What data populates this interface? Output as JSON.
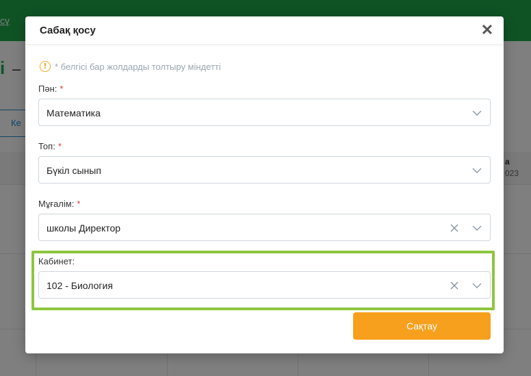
{
  "background": {
    "header_link": "сү",
    "title_fragment": "і",
    "title_dash": "–",
    "button_fragment": "Ке",
    "column_header": "а",
    "column_sub": "023"
  },
  "modal": {
    "title": "Сабақ қосу",
    "close_symbol": "✕",
    "info_icon_symbol": "!",
    "info_text": "* белгісі бар жолдарды толтыру міндетті",
    "required_marker": "*",
    "fields": {
      "subject": {
        "label": "Пән:",
        "value": "Математика",
        "required": true
      },
      "group": {
        "label": "Топ:",
        "value": "Бүкіл сынып",
        "required": true
      },
      "teacher": {
        "label": "Мұғалім:",
        "value": "школы Директор",
        "required": true
      },
      "room": {
        "label": "Кабинет:",
        "value": "102 - Биология",
        "required": false
      }
    },
    "save_label": "Сақтау"
  },
  "colors": {
    "brand_green": "#1fa64a",
    "highlight_green": "#8dc63f",
    "save_orange": "#f7a01d",
    "required_red": "#e53935",
    "info_orange": "#f5a623"
  },
  "icons": {
    "close": "close-icon",
    "info": "info-icon",
    "dropdown": "chevron-down-icon",
    "clear": "clear-icon"
  }
}
